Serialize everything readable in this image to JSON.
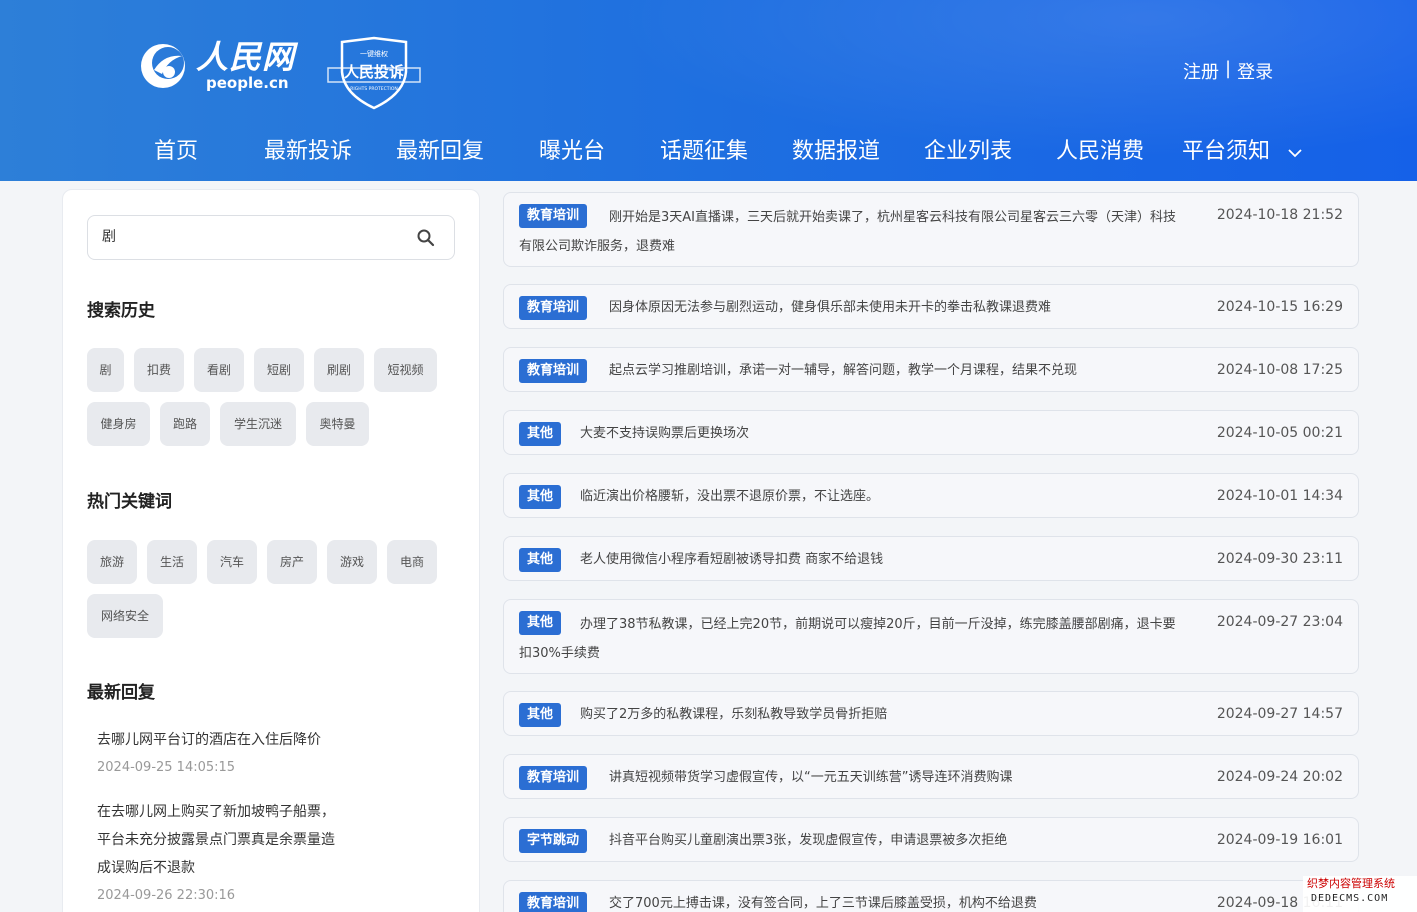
{
  "header": {
    "logo_cn": "人民网",
    "logo_en": "people.cn",
    "badge_top": "一键维权",
    "badge_main": "人民投诉",
    "badge_sub": "RIGHTS PROTECTION",
    "register": "注册",
    "separator": "|",
    "login": "登录"
  },
  "nav": [
    {
      "label": "首页"
    },
    {
      "label": "最新投诉"
    },
    {
      "label": "最新回复"
    },
    {
      "label": "曝光台"
    },
    {
      "label": "话题征集"
    },
    {
      "label": "数据报道"
    },
    {
      "label": "企业列表"
    },
    {
      "label": "人民消费"
    },
    {
      "label": "平台须知"
    }
  ],
  "sidebar": {
    "search_value": "剧",
    "history_title": "搜索历史",
    "history_tags": [
      "剧",
      "扣费",
      "看剧",
      "短剧",
      "刷剧",
      "短视频",
      "健身房",
      "跑路",
      "学生沉迷",
      "奥特曼"
    ],
    "hot_title": "热门关键词",
    "hot_tags": [
      "旅游",
      "生活",
      "汽车",
      "房产",
      "游戏",
      "电商",
      "网络安全"
    ],
    "reply_title": "最新回复",
    "replies": [
      {
        "lines": [
          "去哪儿网平台订的酒店在入住后降价"
        ],
        "time": "2024-09-25 14:05:15"
      },
      {
        "lines": [
          "在去哪儿网上购买了新加坡鸭子船票，",
          "平台未充分披露景点门票真是余票量造",
          "成误购后不退款"
        ],
        "time": "2024-09-26 22:30:16"
      }
    ]
  },
  "complaints": [
    {
      "category": "教育培训",
      "lines": [
        "刚开始是3天AI直播课，三天后就开始卖课了，杭州星客云科技有限公司星客云三六零（天津）科技",
        "有限公司欺诈服务，退费难"
      ],
      "time": "2024-10-18 21:52"
    },
    {
      "category": "教育培训",
      "lines": [
        "因身体原因无法参与剧烈运动，健身俱乐部未使用未开卡的拳击私教课退费难"
      ],
      "time": "2024-10-15 16:29"
    },
    {
      "category": "教育培训",
      "lines": [
        "起点云学习推剧培训，承诺一对一辅导，解答问题，教学一个月课程，结果不兑现"
      ],
      "time": "2024-10-08 17:25"
    },
    {
      "category": "其他",
      "lines": [
        "大麦不支持误购票后更换场次"
      ],
      "time": "2024-10-05 00:21"
    },
    {
      "category": "其他",
      "lines": [
        "临近演出价格腰斩，没出票不退原价票，不让选座。"
      ],
      "time": "2024-10-01 14:34"
    },
    {
      "category": "其他",
      "lines": [
        "老人使用微信小程序看短剧被诱导扣费 商家不给退钱"
      ],
      "time": "2024-09-30 23:11"
    },
    {
      "category": "其他",
      "lines": [
        "办理了38节私教课，已经上完20节，前期说可以瘦掉20斤，目前一斤没掉，练完膝盖腰部剧痛，退卡要",
        "扣30%手续费"
      ],
      "time": "2024-09-27 23:04"
    },
    {
      "category": "其他",
      "lines": [
        "购买了2万多的私教课程，乐刻私教导致学员骨折拒赔"
      ],
      "time": "2024-09-27 14:57"
    },
    {
      "category": "教育培训",
      "lines": [
        "讲真短视频带货学习虚假宣传，以“一元五天训练营”诱导连环消费购课"
      ],
      "time": "2024-09-24 20:02"
    },
    {
      "category": "字节跳动",
      "lines": [
        "抖音平台购买儿童剧演出票3张，发现虚假宣传，申请退票被多次拒绝"
      ],
      "time": "2024-09-19 16:01"
    },
    {
      "category": "教育培训",
      "lines": [
        "交了700元上搏击课，没有签合同，上了三节课后膝盖受损，机构不给退费"
      ],
      "time": "2024-09-18 16:11"
    }
  ],
  "watermark": {
    "line1": "织梦内容管理系统",
    "line2": "DEDECMS.COM"
  }
}
